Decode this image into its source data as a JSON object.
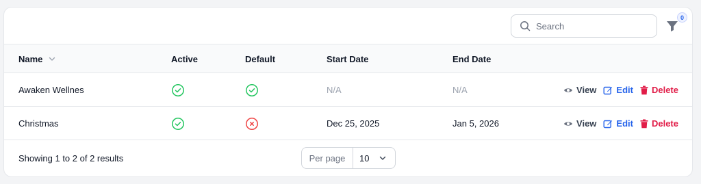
{
  "toolbar": {
    "search_placeholder": "Search",
    "filter_count": "0"
  },
  "table": {
    "columns": {
      "name": "Name",
      "active": "Active",
      "default": "Default",
      "start_date": "Start Date",
      "end_date": "End Date"
    },
    "rows": [
      {
        "name": "Awaken Wellnes",
        "active": true,
        "default": true,
        "start_date": "N/A",
        "end_date": "N/A"
      },
      {
        "name": "Christmas",
        "active": true,
        "default": false,
        "start_date": "Dec 25, 2025",
        "end_date": "Jan 5, 2026"
      }
    ],
    "actions": {
      "view": "View",
      "edit": "Edit",
      "delete": "Delete"
    }
  },
  "footer": {
    "summary": "Showing 1 to 2 of 2 results",
    "per_page_label": "Per page",
    "per_page_value": "10"
  },
  "colors": {
    "check": "#22c55e",
    "cross": "#ef4444",
    "edit": "#2563eb",
    "delete": "#e11d48"
  }
}
